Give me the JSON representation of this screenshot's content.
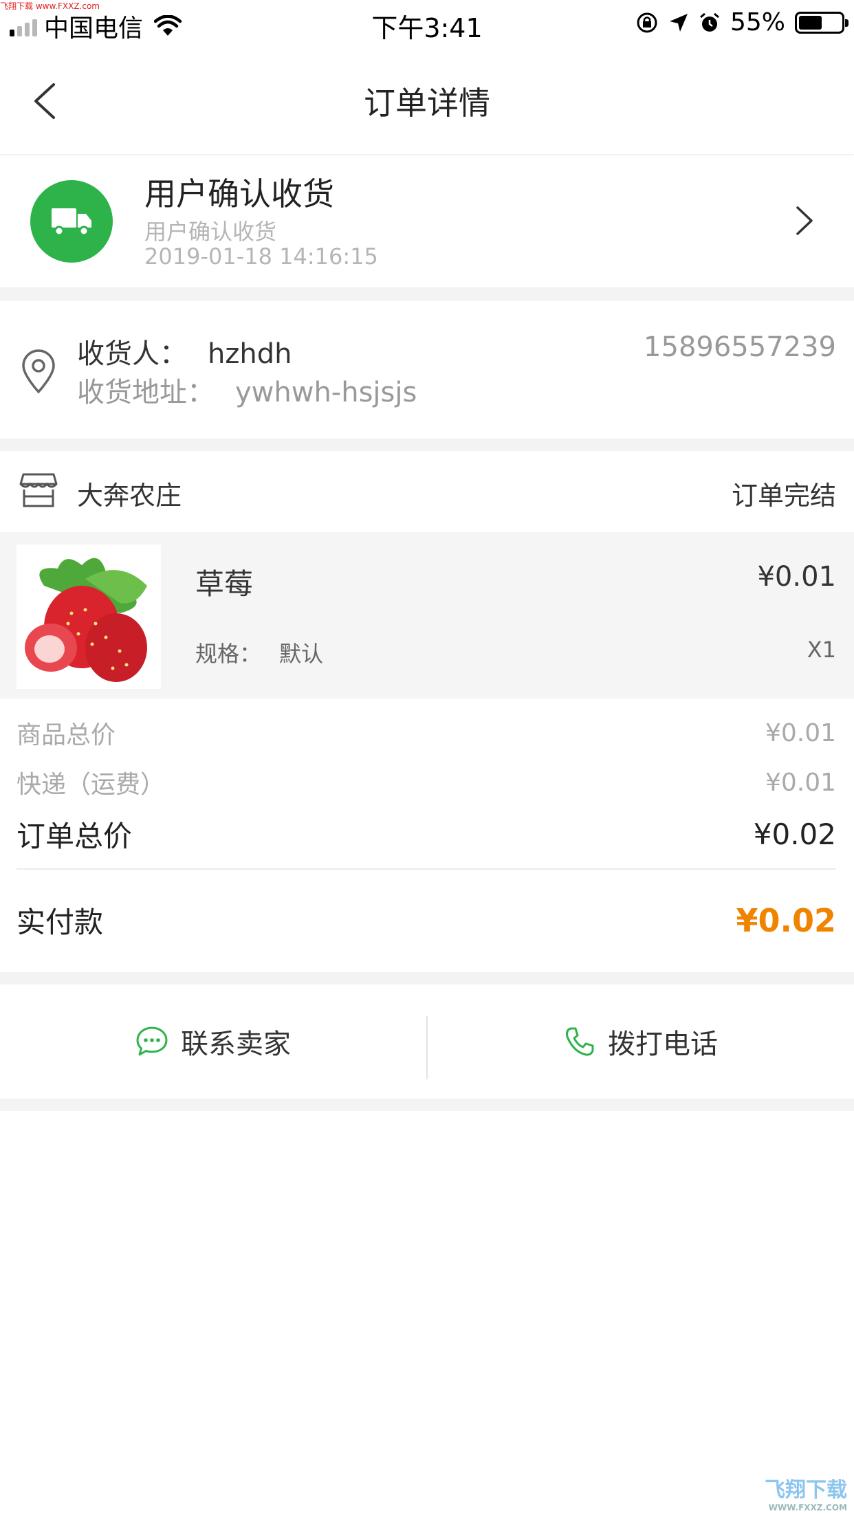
{
  "watermark_top": "飞翔下载 www.FXXZ.com",
  "status_bar": {
    "carrier": "中国电信",
    "time": "下午3:41",
    "battery": "55%",
    "battery_level": 0.55
  },
  "nav": {
    "title": "订单详情"
  },
  "order_status": {
    "title": "用户确认收货",
    "subtitle": "用户确认收货",
    "time": "2019-01-18 14:16:15"
  },
  "address": {
    "receiver_label": "收货人：",
    "receiver": "hzhdh",
    "phone": "15896557239",
    "address_label": "收货地址：",
    "address": "ywhwh-hsjsjs"
  },
  "shop": {
    "name": "大奔农庄",
    "status": "订单完结"
  },
  "product": {
    "name": "草莓",
    "price": "¥0.01",
    "spec_label": "规格：",
    "spec": "默认",
    "qty": "X1"
  },
  "summary": {
    "goods_total_label": "商品总价",
    "goods_total": "¥0.01",
    "shipping_label": "快递（运费）",
    "shipping": "¥0.01",
    "order_total_label": "订单总价",
    "order_total": "¥0.02",
    "paid_label": "实付款",
    "paid": "¥0.02"
  },
  "actions": {
    "contact_seller": "联系卖家",
    "call": "拨打电话"
  },
  "colors": {
    "accent_green": "#2db34a",
    "price_orange": "#f08300"
  },
  "watermark_bottom": "飞翔下载",
  "watermark_bottom_url": "WWW.FXXZ.COM"
}
